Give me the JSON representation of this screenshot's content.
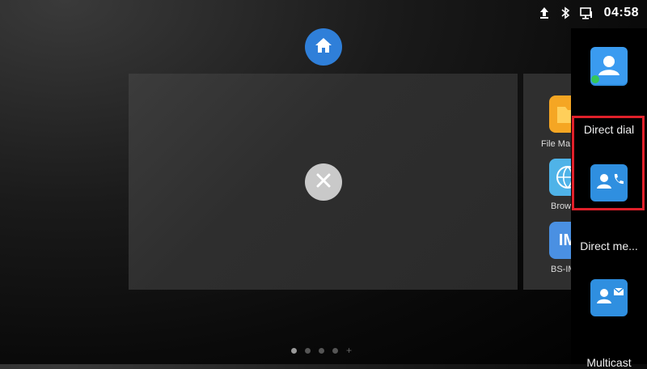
{
  "status_bar": {
    "time": "04:58",
    "icons": [
      "upload-icon",
      "bluetooth-icon",
      "network-icon"
    ]
  },
  "home": {
    "icon": "home-icon"
  },
  "recent_card": {
    "close_icon": "close-icon"
  },
  "peek_card": {
    "apps": [
      {
        "label": "File Ma",
        "icon": "file-manager-icon",
        "color": "#f5a623"
      },
      {
        "label": "Brow",
        "icon": "browser-icon",
        "color": "#4fb3e8"
      },
      {
        "label": "BS-IM",
        "icon": "im-icon",
        "color": "#4a90e2",
        "tile_text": "IM"
      }
    ]
  },
  "dock": {
    "items": [
      {
        "label": "",
        "icon": "contacts-icon"
      },
      {
        "label": "Direct dial",
        "icon": "direct-dial-icon"
      },
      {
        "label": "Direct me...",
        "icon": "direct-message-icon"
      },
      {
        "label": "Multicast",
        "icon": "multicast-icon"
      }
    ]
  },
  "pager": {
    "pages": 4,
    "active": 0
  },
  "colors": {
    "accent": "#2f7fd9",
    "highlight": "#e0202a"
  }
}
